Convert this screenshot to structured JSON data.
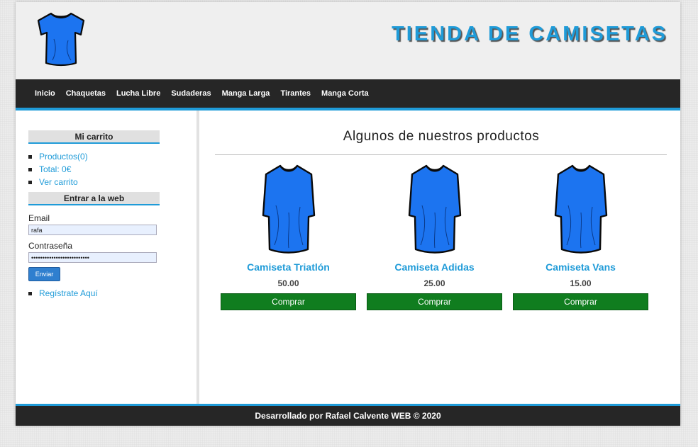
{
  "header": {
    "title": "TIENDA DE CAMISETAS",
    "logo_icon": "tshirt-icon"
  },
  "nav": {
    "items": [
      {
        "label": "Inicio"
      },
      {
        "label": "Chaquetas"
      },
      {
        "label": "Lucha Libre"
      },
      {
        "label": "Sudaderas"
      },
      {
        "label": "Manga Larga"
      },
      {
        "label": "Tirantes"
      },
      {
        "label": "Manga Corta"
      }
    ]
  },
  "sidebar": {
    "cart": {
      "heading": "Mi carrito",
      "items": [
        {
          "label": "Productos(0)"
        },
        {
          "label": "Total: 0€"
        },
        {
          "label": "Ver carrito"
        }
      ]
    },
    "login": {
      "heading": "Entrar a la web",
      "email_label": "Email",
      "email_value": "rafa",
      "password_label": "Contraseña",
      "password_value": "••••••••••••••••••••••••••",
      "submit_label": "Enviar",
      "register_label": "Regístrate Aquí"
    }
  },
  "main": {
    "title": "Algunos de nuestros productos",
    "products": [
      {
        "name": "Camiseta Triatlón",
        "price": "50.00",
        "buy_label": "Comprar"
      },
      {
        "name": "Camiseta Adidas",
        "price": "25.00",
        "buy_label": "Comprar"
      },
      {
        "name": "Camiseta Vans",
        "price": "15.00",
        "buy_label": "Comprar"
      }
    ]
  },
  "footer": {
    "text": "Desarrollado por Rafael Calvente WEB © 2020"
  },
  "colors": {
    "accent": "#1f9bd8",
    "nav_bg": "#262626",
    "buy_button": "#107d1f",
    "shirt": "#1c74f0"
  }
}
